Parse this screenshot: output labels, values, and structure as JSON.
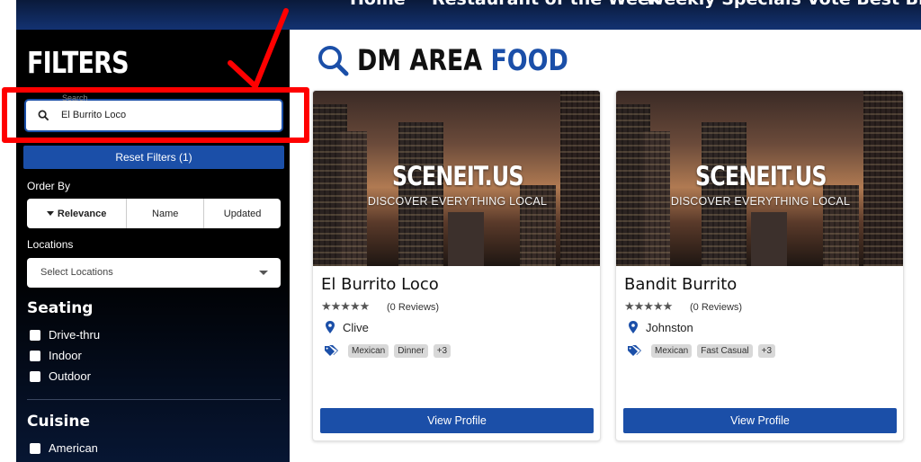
{
  "nav": {
    "items": [
      "Home",
      "Restaurant of the Week",
      "Weekly Specials",
      "Vote Best Bite"
    ]
  },
  "sidebar": {
    "title": "FILTERS",
    "search": {
      "legend": "Search",
      "value": "El Burrito Loco"
    },
    "reset_label": "Reset Filters (1)",
    "order_by": {
      "label": "Order By",
      "options": [
        "Relevance",
        "Name",
        "Updated"
      ],
      "selected": "Relevance"
    },
    "locations": {
      "label": "Locations",
      "placeholder": "Select Locations"
    },
    "seating": {
      "heading": "Seating",
      "options": [
        "Drive-thru",
        "Indoor",
        "Outdoor"
      ]
    },
    "cuisine": {
      "heading": "Cuisine",
      "options": [
        "American"
      ]
    }
  },
  "main": {
    "heading_dark": "DM AREA",
    "heading_blue": "FOOD",
    "cards": [
      {
        "brand": "SCENEIT.US",
        "tagline": "DISCOVER EVERYTHING LOCAL",
        "title": "El Burrito Loco",
        "stars": "★★★★★",
        "reviews": "(0 Reviews)",
        "city": "Clive",
        "tags": [
          "Mexican",
          "Dinner",
          "+3"
        ],
        "button": "View Profile"
      },
      {
        "brand": "SCENEIT.US",
        "tagline": "DISCOVER EVERYTHING LOCAL",
        "title": "Bandit Burrito",
        "stars": "★★★★★",
        "reviews": "(0 Reviews)",
        "city": "Johnston",
        "tags": [
          "Mexican",
          "Fast Casual",
          "+3"
        ],
        "button": "View Profile"
      }
    ]
  },
  "colors": {
    "accent": "#1b4fa8",
    "annotation": "#ff0000",
    "sidebar_bg": "#000000"
  },
  "icons": [
    "search-icon",
    "caret-down-icon",
    "map-pin-icon",
    "tag-icon",
    "star-icon",
    "annotation-arrow"
  ]
}
